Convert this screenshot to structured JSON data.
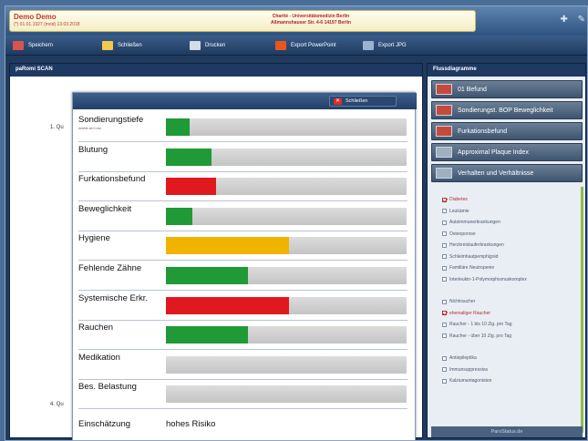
{
  "patient": {
    "name": "Demo Demo",
    "dob": "(*) 01.01.1927    (mod) 13.03.2018",
    "clinic_line1": "Charité - Universitätsmedizin Berlin",
    "clinic_line2": "Aßmannshauser Str. 4-6 14197 Berlin"
  },
  "top_icons": [
    "plus-icon",
    "tools-icon"
  ],
  "toolbar": {
    "save": "Speichern",
    "close": "Schließen",
    "print": "Drucken",
    "export_ppt": "Export PowerPoint",
    "export_jpg": "Export JPG"
  },
  "left": {
    "title": "paRomi SCAN",
    "bg_label_1": "1. Qu",
    "bg_label_4": "4. Qu"
  },
  "overlay": {
    "close_label": "Schließen",
    "rows": [
      {
        "label": "Sondierungstiefe",
        "sub": "Anteile ab 5 mm",
        "value": 0.1,
        "color": "#1f9a37"
      },
      {
        "label": "Blutung",
        "sub": "",
        "value": 0.19,
        "color": "#1f9a37"
      },
      {
        "label": "Furkationsbefund",
        "sub": "",
        "value": 0.21,
        "color": "#e0191f"
      },
      {
        "label": "Beweglichkeit",
        "sub": "",
        "value": 0.11,
        "color": "#1f9a37"
      },
      {
        "label": "Hygiene",
        "sub": "",
        "value": 0.51,
        "color": "#f0b400"
      },
      {
        "label": "Fehlende Zähne",
        "sub": "",
        "value": 0.34,
        "color": "#1f9a37"
      },
      {
        "label": "Systemische Erkr.",
        "sub": "",
        "value": 0.51,
        "color": "#e0191f"
      },
      {
        "label": "Rauchen",
        "sub": "",
        "value": 0.34,
        "color": "#1f9a37"
      },
      {
        "label": "Medikation",
        "sub": "",
        "value": 0,
        "color": "#1f9a37"
      },
      {
        "label": "Bes. Belastung",
        "sub": "",
        "value": 0,
        "color": "#1f9a37"
      }
    ],
    "assessment_label": "Einschätzung",
    "assessment_value": "hohes Risiko"
  },
  "right": {
    "title": "Flussdiagramme",
    "buttons": [
      "01 Befund",
      "Sondierungst. BOP Beweglichkeit",
      "Furkationsbefund",
      "Approximal Plaque Index",
      "Verhalten und Verhältnisse"
    ],
    "group1": [
      {
        "label": "Diabetes",
        "checked": true
      },
      {
        "label": "Leukämie",
        "checked": false
      },
      {
        "label": "Autoimmunerkrankungen",
        "checked": false
      },
      {
        "label": "Osteoporose",
        "checked": false
      },
      {
        "label": "Herzkreislauferkrankungen",
        "checked": false
      },
      {
        "label": "Schleimhautpemphigoid",
        "checked": false
      },
      {
        "label": "Familiäre Neutropenie",
        "checked": false
      },
      {
        "label": "Interleukin-1-Polymorphismuskomplex",
        "checked": false
      }
    ],
    "group2": [
      {
        "label": "Nichtraucher",
        "checked": false
      },
      {
        "label": "ehemaliger Raucher",
        "checked": true
      },
      {
        "label": "Raucher - 1 bis 10 Zig. pro Tag",
        "checked": false
      },
      {
        "label": "Raucher - über 10 Zig. pro Tag",
        "checked": false
      }
    ],
    "group3": [
      {
        "label": "Antiepileptika",
        "checked": false
      },
      {
        "label": "Immunsuppressiva",
        "checked": false
      },
      {
        "label": "Kalziumantagonisten",
        "checked": false
      }
    ],
    "footer": "ParoStatus.de"
  }
}
